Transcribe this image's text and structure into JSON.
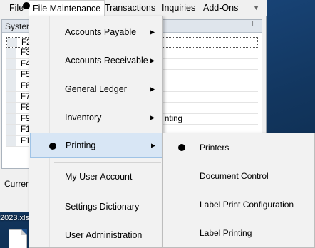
{
  "menubar": {
    "items": [
      "File",
      "File Maintenance",
      "Transactions",
      "Inquiries",
      "Add-Ons"
    ],
    "overflow_icon": "chevron-down-icon"
  },
  "panel": {
    "title": "Syster",
    "pin_icon": "pin-icon",
    "rows": [
      {
        "key": "F2",
        "text": ""
      },
      {
        "key": "F3",
        "text": ""
      },
      {
        "key": "F4",
        "text": ""
      },
      {
        "key": "F5",
        "text": ""
      },
      {
        "key": "F6",
        "text": ""
      },
      {
        "key": "F7",
        "text": ""
      },
      {
        "key": "F8",
        "text": ""
      },
      {
        "key": "F9",
        "text": "nting"
      },
      {
        "key": "F1",
        "text": ""
      },
      {
        "key": "F1",
        "text": ""
      }
    ]
  },
  "status": {
    "left_text": "Curren"
  },
  "desktop": {
    "file_label": "2023.xls"
  },
  "dropdown": {
    "items": [
      {
        "label": "Accounts Payable",
        "has_submenu": true
      },
      {
        "label": "Accounts Receivable",
        "has_submenu": true
      },
      {
        "label": "General Ledger",
        "has_submenu": true
      },
      {
        "label": "Inventory",
        "has_submenu": true
      },
      {
        "label": "Printing",
        "has_submenu": true,
        "highlighted": true
      },
      {
        "label": "My User Account",
        "has_submenu": false
      },
      {
        "label": "Settings Dictionary",
        "has_submenu": false
      },
      {
        "label": "User Administration",
        "has_submenu": false
      }
    ]
  },
  "submenu": {
    "items": [
      "Printers",
      "Document Control",
      "Label Print Configuration",
      "Label Printing"
    ]
  },
  "colors": {
    "highlight": "#d8e6f5",
    "highlight_border": "#9fc3e6",
    "menu_bg": "#f2f2f2"
  }
}
